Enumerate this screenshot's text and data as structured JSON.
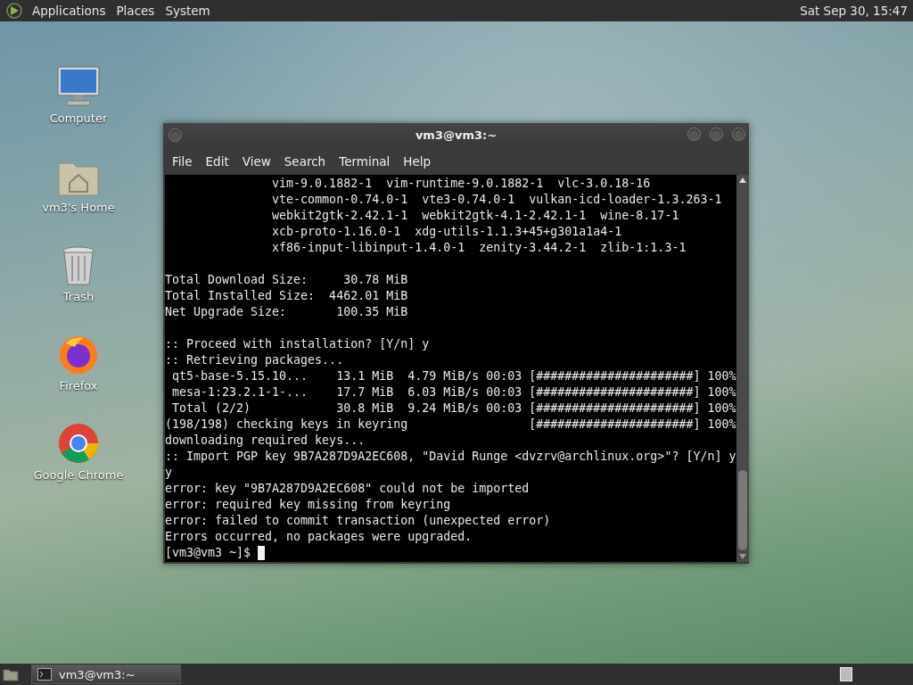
{
  "top_panel": {
    "menus": [
      "Applications",
      "Places",
      "System"
    ],
    "clock": "Sat Sep 30, 15:47"
  },
  "desktop_icons": [
    {
      "kind": "computer",
      "label": "Computer"
    },
    {
      "kind": "home",
      "label": "vm3's Home"
    },
    {
      "kind": "trash",
      "label": "Trash"
    },
    {
      "kind": "firefox",
      "label": "Firefox"
    },
    {
      "kind": "chrome",
      "label": "Google Chrome"
    }
  ],
  "terminal": {
    "title": "vm3@vm3:~",
    "menu": [
      "File",
      "Edit",
      "View",
      "Search",
      "Terminal",
      "Help"
    ],
    "blocks": [
      [
        "               vim-9.0.1882-1  vim-runtime-9.0.1882-1  vlc-3.0.18-16",
        "               vte-common-0.74.0-1  vte3-0.74.0-1  vulkan-icd-loader-1.3.263-1",
        "               webkit2gtk-2.42.1-1  webkit2gtk-4.1-2.42.1-1  wine-8.17-1",
        "               xcb-proto-1.16.0-1  xdg-utils-1.1.3+45+g301a1a4-1",
        "               xf86-input-libinput-1.4.0-1  zenity-3.44.2-1  zlib-1:1.3-1"
      ],
      [
        "Total Download Size:     30.78 MiB",
        "Total Installed Size:  4462.01 MiB",
        "Net Upgrade Size:       100.35 MiB"
      ],
      [
        ":: Proceed with installation? [Y/n] y",
        ":: Retrieving packages...",
        " qt5-base-5.15.10...    13.1 MiB  4.79 MiB/s 00:03 [######################] 100%",
        " mesa-1:23.2.1-1-...    17.7 MiB  6.03 MiB/s 00:03 [######################] 100%",
        " Total (2/2)            30.8 MiB  9.24 MiB/s 00:03 [######################] 100%",
        "(198/198) checking keys in keyring                 [######################] 100%",
        "downloading required keys...",
        ":: Import PGP key 9B7A287D9A2EC608, \"David Runge <dvzrv@archlinux.org>\"? [Y/n] y",
        "y",
        "error: key \"9B7A287D9A2EC608\" could not be imported",
        "error: required key missing from keyring",
        "error: failed to commit transaction (unexpected error)",
        "Errors occurred, no packages were upgraded."
      ]
    ],
    "prompt": "[vm3@vm3 ~]$ "
  },
  "taskbar": {
    "items": [
      {
        "label": "vm3@vm3:~",
        "selected": false
      }
    ]
  }
}
